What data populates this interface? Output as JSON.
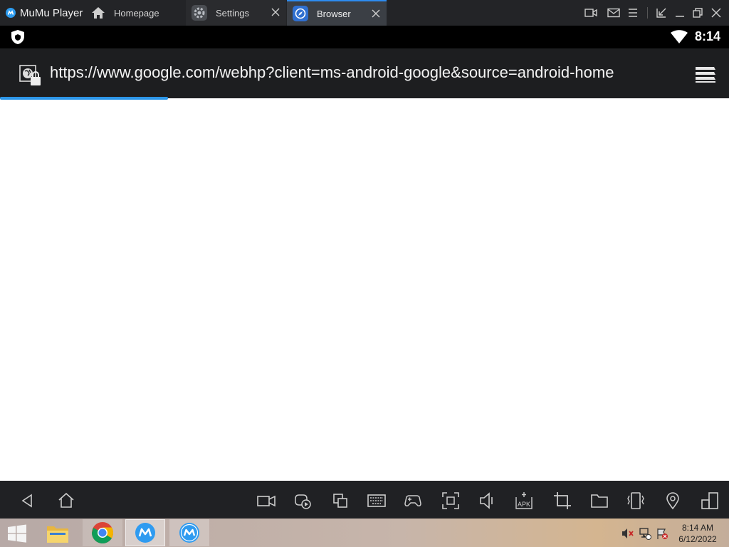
{
  "app": {
    "title": "MuMu Player",
    "tabs": [
      {
        "label": "Homepage",
        "icon": "home-icon",
        "active": false
      },
      {
        "label": "Settings",
        "icon": "gear-icon",
        "active": false
      },
      {
        "label": "Browser",
        "icon": "compass-icon",
        "active": true
      }
    ],
    "window_controls": [
      "record-icon",
      "mail-icon",
      "menu-icon",
      "shrink-icon",
      "minimize-icon",
      "restore-icon",
      "close-icon"
    ]
  },
  "android_status": {
    "time": "8:14",
    "icons": [
      "shield-icon",
      "wifi-icon"
    ]
  },
  "browser": {
    "url": "https://www.google.com/webhp?client=ms-android-google&source=android-home",
    "load_progress": 0.23,
    "icons": [
      "globe-lock-icon",
      "menu-stack-icon"
    ]
  },
  "toolbar": {
    "nav": [
      "back-icon",
      "home-icon"
    ],
    "tools": [
      "screen-record-icon",
      "gamepad-record-icon",
      "multi-window-icon",
      "keyboard-icon",
      "game-controller-icon",
      "fullscreen-icon",
      "volume-icon",
      "apk-install-icon",
      "crop-icon",
      "folder-icon",
      "shake-icon",
      "location-icon",
      "rotate-icon"
    ]
  },
  "taskbar": {
    "apps": [
      "windows-start-icon",
      "file-explorer-icon",
      "chrome-icon",
      "mumu-icon",
      "mumu-icon"
    ],
    "time": "8:14 AM",
    "date": "6/12/2022"
  },
  "colors": {
    "accent": "#2d8cf0",
    "progress": "#2c96e8",
    "titlebar": "#232427",
    "urlbar": "#1d1e20"
  }
}
